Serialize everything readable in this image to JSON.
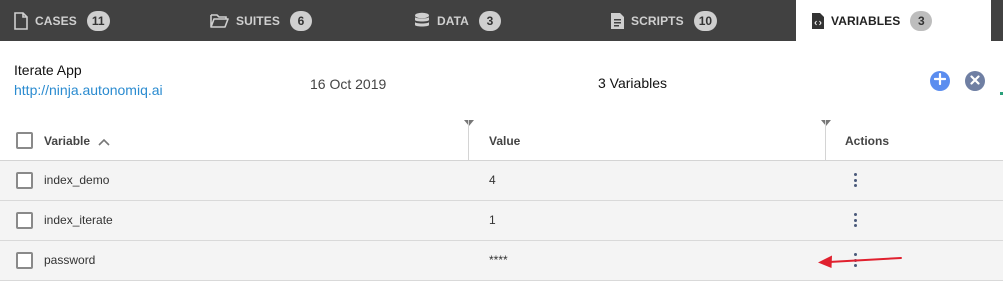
{
  "tabs": [
    {
      "label": "CASES",
      "count": "11",
      "icon": "file-icon",
      "active": false
    },
    {
      "label": "SUITES",
      "count": "6",
      "icon": "folder-open-icon",
      "active": false
    },
    {
      "label": "DATA",
      "count": "3",
      "icon": "database-icon",
      "active": false
    },
    {
      "label": "SCRIPTS",
      "count": "10",
      "icon": "script-icon",
      "active": false
    },
    {
      "label": "VARIABLES",
      "count": "3",
      "icon": "code-file-icon",
      "active": true
    }
  ],
  "info": {
    "app_name": "Iterate App",
    "app_url": "http://ninja.autonomiq.ai",
    "date": "16 Oct 2019",
    "variables_count": "3 Variables"
  },
  "table": {
    "columns": {
      "variable": "Variable",
      "value": "Value",
      "actions": "Actions"
    },
    "rows": [
      {
        "variable": "index_demo",
        "value": "4"
      },
      {
        "variable": "index_iterate",
        "value": "1"
      },
      {
        "variable": "password",
        "value": "****"
      }
    ]
  },
  "colors": {
    "tabbar_bg": "#414141",
    "link": "#2a8bd0",
    "add_button": "#5b8def",
    "close_button": "#6f7fa3",
    "annotation_arrow": "#e0202e"
  }
}
